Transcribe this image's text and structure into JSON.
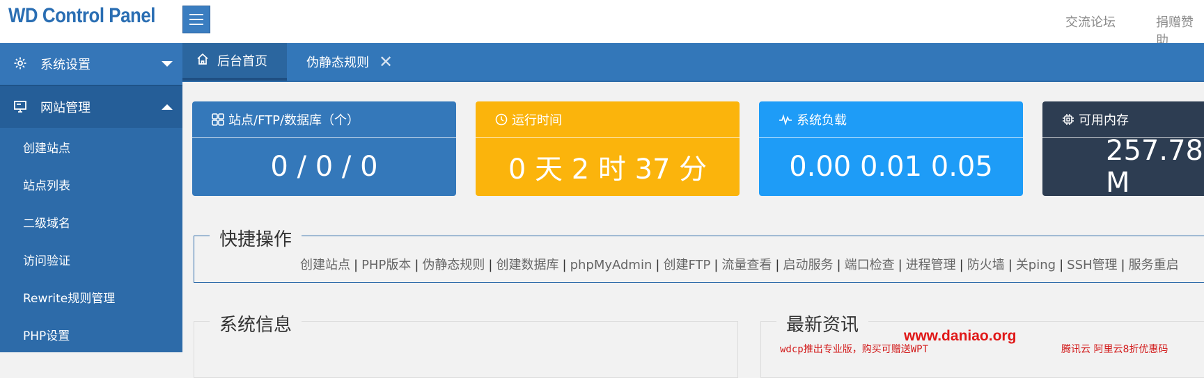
{
  "app": {
    "logo": "WD Control Panel"
  },
  "top_links": [
    "交流论坛",
    "捐赠赞助"
  ],
  "sidebar": {
    "groups": [
      {
        "label": "系统设置",
        "icon": "gear-icon",
        "expanded": false
      },
      {
        "label": "网站管理",
        "icon": "monitor-icon",
        "expanded": true
      }
    ],
    "items": [
      {
        "label": "创建站点"
      },
      {
        "label": "站点列表"
      },
      {
        "label": "二级域名"
      },
      {
        "label": "访问验证"
      },
      {
        "label": "Rewrite规则管理"
      },
      {
        "label": "PHP设置"
      }
    ]
  },
  "tabs": [
    {
      "label": "后台首页",
      "icon": "home-icon",
      "active": true
    },
    {
      "label": "伪静态规则",
      "closable": true
    }
  ],
  "cards": [
    {
      "title": "站点/FTP/数据库（个）",
      "value": "0 / 0 / 0",
      "icon": "grid-icon",
      "color": "#3478ba"
    },
    {
      "title": "运行时间",
      "value": "0 天 2 时 37 分",
      "icon": "clock-icon",
      "color": "#fbb40c"
    },
    {
      "title": "系统负载",
      "value": "0.00 0.01 0.05",
      "icon": "pulse-icon",
      "color": "#1e9cf7"
    },
    {
      "title": "可用内存",
      "value": "257.78 M",
      "icon": "chip-icon",
      "color": "#2d3d52"
    }
  ],
  "quick": {
    "title": "快捷操作",
    "links": [
      "创建站点",
      "PHP版本",
      "伪静态规则",
      "创建数据库",
      "phpMyAdmin",
      "创建FTP",
      "流量查看",
      "启动服务",
      "端口检查",
      "进程管理",
      "防火墙",
      "关ping",
      "SSH管理",
      "服务重启"
    ]
  },
  "system_info": {
    "title": "系统信息"
  },
  "news": {
    "title": "最新资讯",
    "watermark": "www.daniao.org",
    "item_1": "wdcp推出专业版，购买可赠送WPT",
    "item_2": "腾讯云 阿里云8折优惠码"
  }
}
